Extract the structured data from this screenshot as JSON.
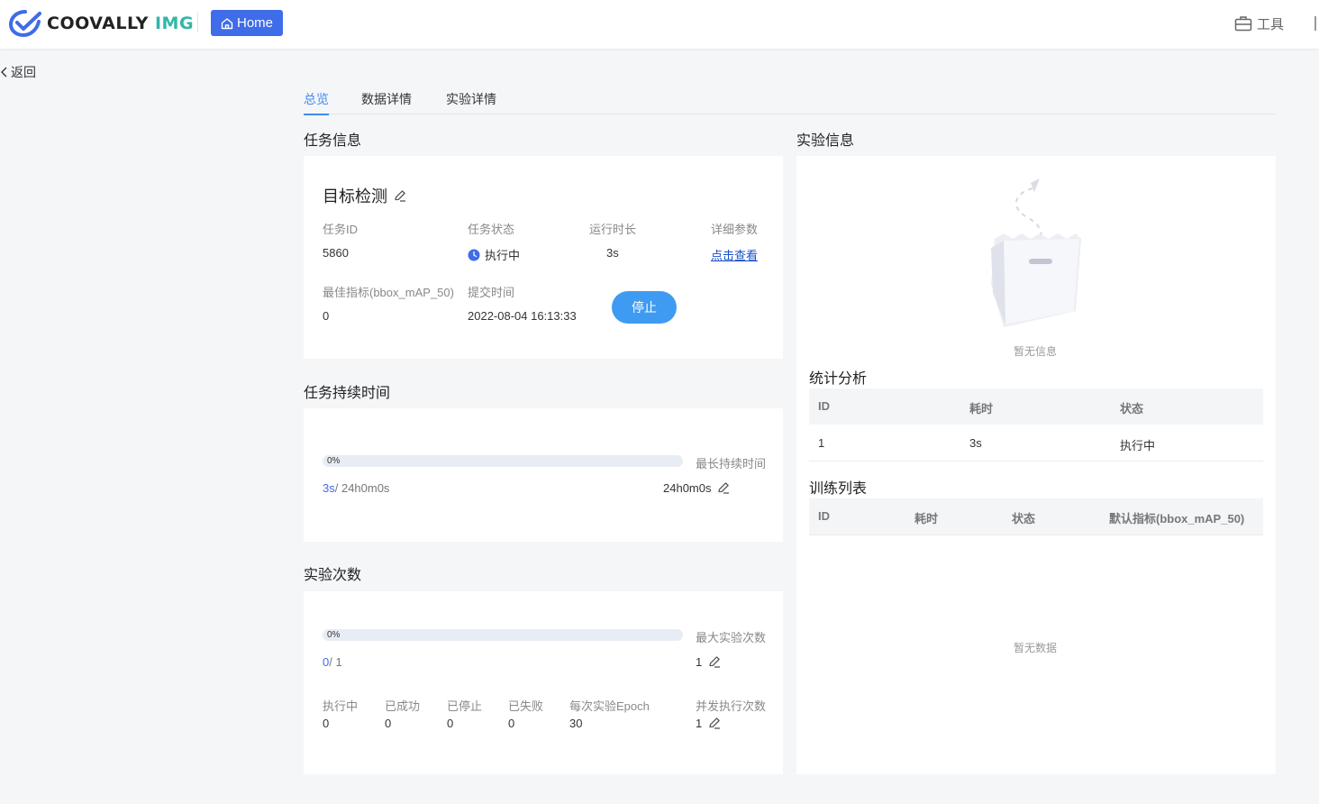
{
  "header": {
    "logo_main": "COOVALLY ",
    "logo_img": "IMG",
    "home_label": "Home",
    "tools_label": "工具"
  },
  "nav": {
    "back_label": "返回"
  },
  "tabs": [
    {
      "label": "总览",
      "active": true
    },
    {
      "label": "数据详情",
      "active": false
    },
    {
      "label": "实验详情",
      "active": false
    }
  ],
  "task_info": {
    "section_title": "任务信息",
    "task_name": "目标检测",
    "fields": {
      "task_id_label": "任务ID",
      "task_id": "5860",
      "status_label": "任务状态",
      "status": "执行中",
      "runtime_label": "运行时长",
      "runtime": "3s",
      "params_label": "详细参数",
      "params_link": "点击查看",
      "metric_label": "最佳指标(bbox_mAP_50)",
      "metric": "0",
      "submit_label": "提交时间",
      "submit_time": "2022-08-04 16:13:33"
    },
    "stop_label": "停止"
  },
  "duration": {
    "section_title": "任务持续时间",
    "progress_pct_label": "0%",
    "progress_fraction": 0,
    "max_label": "最长持续时间",
    "current": "3s",
    "separator_total": "/ 24h0m0s",
    "max_value": "24h0m0s"
  },
  "experiments": {
    "section_title": "实验次数",
    "progress_pct_label": "0%",
    "progress_fraction": 0,
    "max_label": "最大实验次数",
    "current": "0",
    "separator_total": "/ 1",
    "max_value": "1",
    "stats": [
      {
        "label": "执行中",
        "value": "0"
      },
      {
        "label": "已成功",
        "value": "0"
      },
      {
        "label": "已停止",
        "value": "0"
      },
      {
        "label": "已失败",
        "value": "0"
      },
      {
        "label": "每次实验Epoch",
        "value": "30"
      }
    ],
    "concurrency_label": "并发执行次数",
    "concurrency_value": "1"
  },
  "experiment_info": {
    "section_title": "实验信息",
    "empty_text": "暂无信息"
  },
  "stats_analysis": {
    "section_title": "统计分析",
    "columns": [
      "ID",
      "耗时",
      "状态"
    ],
    "rows": [
      {
        "id": "1",
        "time": "3s",
        "status": "执行中"
      }
    ]
  },
  "training_list": {
    "section_title": "训练列表",
    "columns": [
      "ID",
      "耗时",
      "状态",
      "默认指标(bbox_mAP_50)"
    ],
    "empty_text": "暂无数据"
  },
  "colors": {
    "primary": "#3f6ce8",
    "accent": "#3f8bf0",
    "stop_button": "#3f9bf2"
  }
}
